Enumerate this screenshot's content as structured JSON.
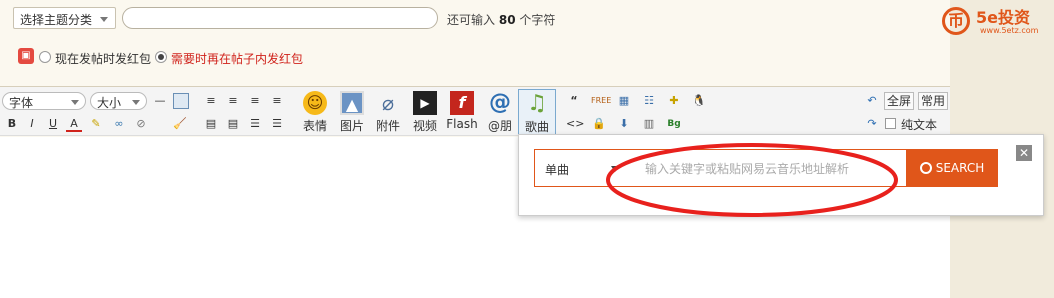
{
  "form": {
    "subject_select": "选择主题分类",
    "title_placeholder": "",
    "remain_prefix": "还可输入",
    "remain_count": "80",
    "remain_suffix": "个字符",
    "redpack_option1": "现在发帖时发红包",
    "redpack_option2": "需要时再在帖子内发红包"
  },
  "logo": {
    "name": "5e投资",
    "site": "www.5etz.com",
    "mark": "币"
  },
  "toolbar": {
    "font_label": "字体",
    "size_label": "大小",
    "format_buttons": [
      "B",
      "I",
      "U",
      "A"
    ],
    "emoji_label": "表情",
    "image_label": "图片",
    "attach_label": "附件",
    "video_label": "视频",
    "flash_label": "Flash",
    "at_label": "@朋",
    "music_label": "歌曲",
    "fullscreen_label": "全屏",
    "common_label": "常用",
    "plaintext_label": "纯文本"
  },
  "music_popup": {
    "type_selected": "单曲",
    "input_placeholder": "输入关键字或粘贴网易云音乐地址解析",
    "search_label": "SEARCH",
    "close_symbol": "✕"
  },
  "colors": {
    "accent": "#e0561a",
    "red_text": "#d0231c",
    "annotation_red": "#e8211d"
  },
  "icons": {
    "redpack": "red-packet-icon",
    "search": "search-icon"
  }
}
